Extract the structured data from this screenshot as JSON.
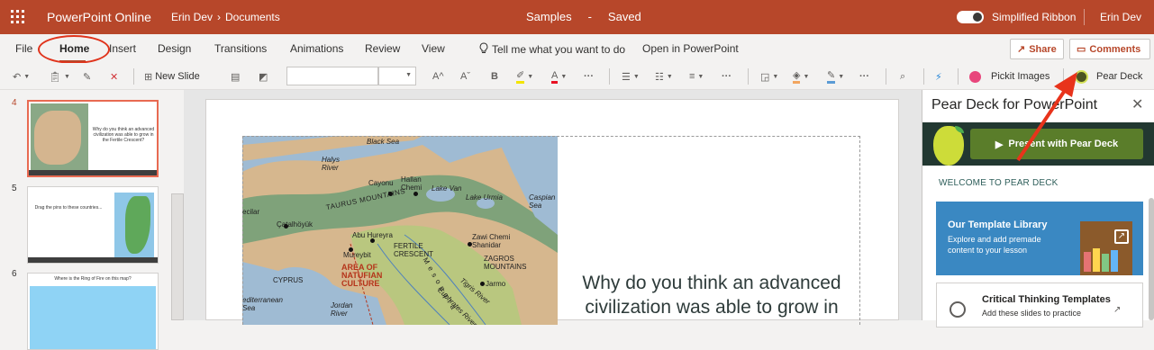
{
  "titlebar": {
    "app_name": "PowerPoint Online",
    "breadcrumb": [
      "Erin Dev",
      "Documents"
    ],
    "doc_name": "Samples",
    "separator": "-",
    "save_status": "Saved",
    "simplified_ribbon_label": "Simplified Ribbon",
    "simplified_ribbon_on": true,
    "user": "Erin Dev"
  },
  "menu": {
    "tabs": [
      "File",
      "Home",
      "Insert",
      "Design",
      "Transitions",
      "Animations",
      "Review",
      "View"
    ],
    "active_tab": "Home",
    "tell_me": "Tell me what you want to do",
    "open_in": "Open in PowerPoint",
    "share": "Share",
    "comments": "Comments"
  },
  "ribbon": {
    "new_slide": "New Slide",
    "font_name": "",
    "font_size": "",
    "pickit": "Pickit Images",
    "pear_deck": "Pear Deck"
  },
  "thumbnails": [
    {
      "number": "4",
      "selected": true,
      "text": "Why do you think an advanced civilization was able to grow in the Fertile Crescent?"
    },
    {
      "number": "5",
      "selected": false,
      "text": "Drag the pins to these countries..."
    },
    {
      "number": "6",
      "selected": false,
      "text": "Where is the Ring of Fire on this map?"
    }
  ],
  "slide": {
    "map_labels": {
      "black_sea": "Black Sea",
      "halys": "Halys River",
      "cayonu": "Cayonu",
      "hallan": "Hallan Chemi",
      "lake_van": "Lake Van",
      "lake_urmia": "Lake Urmia",
      "caspian": "Caspian Sea",
      "taurus": "TAURUS MOUNTAINS",
      "catal": "Çatalhöyük",
      "catal_left": "ecilar",
      "abu": "Abu Hureyra",
      "fertile": "FERTILE CRESCENT",
      "zawi": "Zawi Chemi Shanidar",
      "zagros": "ZAGROS MOUNTAINS",
      "mureybit": "Mureybit",
      "natufian": "AREA OF NATUFIAN CULTURE",
      "cyprus": "CYPRUS",
      "med": "editerranean Sea",
      "jordan": "Jordan River",
      "jarmo": "Jarmo",
      "tigris": "Tigris River",
      "euphrates": "Euphrates River",
      "meso": "M e s o p o t a"
    },
    "question": "Why do you think an advanced civilization was able to grow in"
  },
  "pane": {
    "title": "Pear Deck for PowerPoint",
    "present_button": "Present with Pear Deck",
    "welcome": "WELCOME TO PEAR DECK",
    "template_title": "Our Template Library",
    "template_desc": "Explore and add premade content to your lesson",
    "critical_title": "Critical Thinking Templates",
    "critical_desc": "Add these slides to practice"
  },
  "colors": {
    "brand": "#b7472a",
    "highlight": "#e0331b",
    "pear_banner": "#223831",
    "present_green": "#5a7d2a",
    "template_blue": "#3a88c2"
  }
}
